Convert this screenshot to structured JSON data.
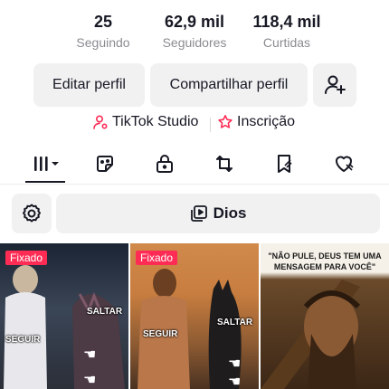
{
  "stats": [
    {
      "value": "25",
      "label": "Seguindo"
    },
    {
      "value": "62,9 mil",
      "label": "Seguidores"
    },
    {
      "value": "118,4 mil",
      "label": "Curtidas"
    }
  ],
  "actions": {
    "edit_label": "Editar perfil",
    "share_label": "Compartilhar perfil"
  },
  "links": {
    "studio_label": "TikTok Studio",
    "subscription_label": "Inscrição",
    "accent_color": "#fe2c55"
  },
  "tabs": [
    {
      "icon": "grid-icon",
      "selected": true
    },
    {
      "icon": "sticker-icon"
    },
    {
      "icon": "lock-icon"
    },
    {
      "icon": "repost-icon"
    },
    {
      "icon": "bookmark-icon"
    },
    {
      "icon": "heart-icon"
    }
  ],
  "playlist": {
    "label": "Dios"
  },
  "videos": [
    {
      "pinned_label": "Fixado",
      "overlay": [
        "SALTAR",
        "SEGUIR"
      ]
    },
    {
      "pinned_label": "Fixado",
      "overlay": [
        "SALTAR",
        "SEGUIR"
      ]
    },
    {
      "title": "\"NÃO PULE, DEUS TEM UMA MENSAGEM PARA VOCÊ\""
    }
  ]
}
